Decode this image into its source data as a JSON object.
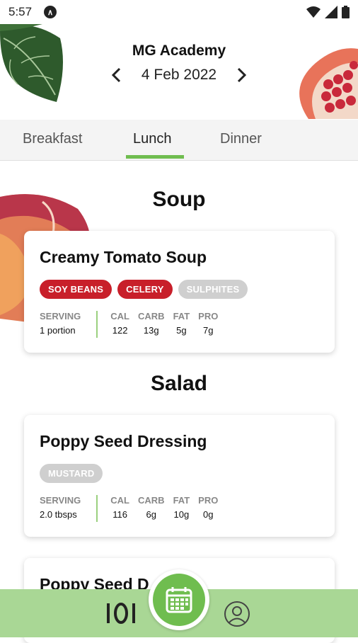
{
  "status_bar": {
    "time": "5:57",
    "app_icon_glyph": "∧"
  },
  "header": {
    "title": "MG Academy",
    "date": "4 Feb 2022"
  },
  "tabs": [
    {
      "label": "Breakfast"
    },
    {
      "label": "Lunch"
    },
    {
      "label": "Dinner"
    }
  ],
  "sections": [
    {
      "title": "Soup",
      "items": [
        {
          "name": "Creamy Tomato Soup",
          "allergens": [
            "SOY BEANS",
            "CELERY",
            "SULPHITES"
          ],
          "serving_label": "SERVING",
          "serving": "1 portion",
          "cal_label": "CAL",
          "cal": "122",
          "carb_label": "CARB",
          "carb": "13g",
          "fat_label": "FAT",
          "fat": "5g",
          "pro_label": "PRO",
          "pro": "7g"
        }
      ]
    },
    {
      "title": "Salad",
      "items": [
        {
          "name": "Poppy Seed Dressing",
          "allergens": [
            "MUSTARD"
          ],
          "serving_label": "SERVING",
          "serving": "2.0 tbsps",
          "cal_label": "CAL",
          "cal": "116",
          "carb_label": "CARB",
          "carb": "6g",
          "fat_label": "FAT",
          "fat": "10g",
          "pro_label": "PRO",
          "pro": "0g"
        },
        {
          "name": "Poppy Seed D"
        }
      ]
    }
  ],
  "colors": {
    "accent_green": "#6fbd4f",
    "bottom_bar": "#a9d795",
    "allergen_red": "#c81f2a",
    "allergen_grey": "#cfcfcf"
  },
  "icons": [
    "wifi-icon",
    "signal-icon",
    "battery-icon",
    "chevron-left-icon",
    "chevron-right-icon",
    "cutlery-icon",
    "calendar-icon",
    "profile-icon"
  ]
}
